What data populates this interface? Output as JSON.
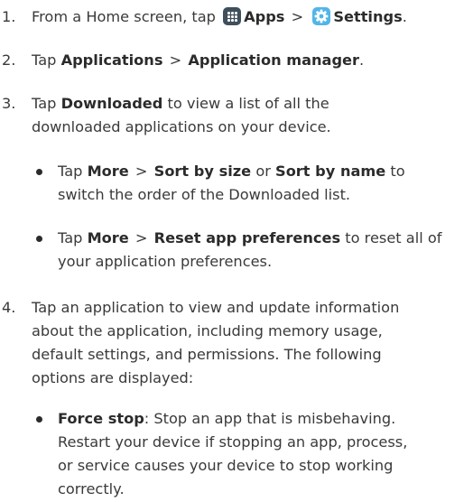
{
  "steps": [
    {
      "num": "1.",
      "text_a": "From a Home screen, tap",
      "apps_label": "Apps",
      "sep": ">",
      "settings_label": "Settings",
      "end": ".",
      "icons": [
        "apps-grid-icon",
        "settings-gear-icon"
      ]
    },
    {
      "num": "2.",
      "text_a": "Tap",
      "b1": "Applications",
      "sep": ">",
      "b2": "Application manager",
      "end": "."
    },
    {
      "num": "3.",
      "text_a": "Tap",
      "b1": "Downloaded",
      "text_b": "to view a list of all the",
      "line2": "downloaded applications on your device.",
      "bullets": [
        {
          "a": "Tap",
          "b1": "More",
          "sep": ">",
          "b2": "Sort by size",
          "or": "or",
          "b3": "Sort by name",
          "c": "to",
          "line2": "switch the order of the Downloaded list."
        },
        {
          "a": "Tap",
          "b1": "More",
          "sep": ">",
          "b2": "Reset app preferences",
          "c": "to reset all of",
          "line2": "your application preferences."
        }
      ]
    },
    {
      "num": "4.",
      "lines": [
        "Tap an application to view and update information",
        "about the application, including memory usage,",
        "default settings, and permissions. The following",
        "options are displayed:"
      ],
      "bullets": [
        {
          "b1": "Force stop",
          "a": ": Stop an app that is misbehaving.",
          "lines": [
            "Restart your device if stopping an app, process,",
            "or service causes your device to stop working",
            "correctly."
          ]
        }
      ]
    }
  ],
  "colors": {
    "text": "#3a3a3a",
    "bold": "#2b2b2b",
    "apps_icon_bg": "#3f4f5c",
    "settings_icon_bg": "#52b5e8"
  }
}
